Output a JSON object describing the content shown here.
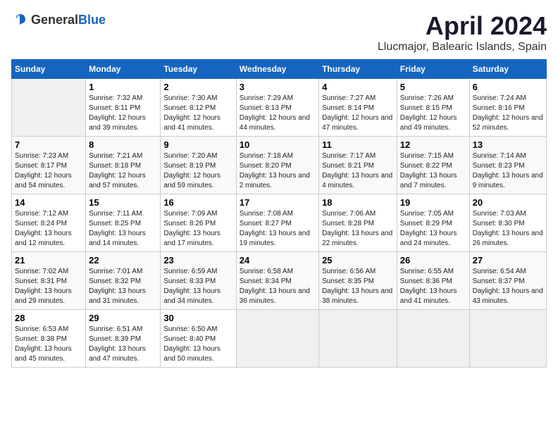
{
  "header": {
    "logo_general": "General",
    "logo_blue": "Blue",
    "title": "April 2024",
    "subtitle": "Llucmajor, Balearic Islands, Spain"
  },
  "columns": [
    "Sunday",
    "Monday",
    "Tuesday",
    "Wednesday",
    "Thursday",
    "Friday",
    "Saturday"
  ],
  "weeks": [
    [
      {
        "day": "",
        "sunrise": "",
        "sunset": "",
        "daylight": ""
      },
      {
        "day": "1",
        "sunrise": "Sunrise: 7:32 AM",
        "sunset": "Sunset: 8:11 PM",
        "daylight": "Daylight: 12 hours and 39 minutes."
      },
      {
        "day": "2",
        "sunrise": "Sunrise: 7:30 AM",
        "sunset": "Sunset: 8:12 PM",
        "daylight": "Daylight: 12 hours and 41 minutes."
      },
      {
        "day": "3",
        "sunrise": "Sunrise: 7:29 AM",
        "sunset": "Sunset: 8:13 PM",
        "daylight": "Daylight: 12 hours and 44 minutes."
      },
      {
        "day": "4",
        "sunrise": "Sunrise: 7:27 AM",
        "sunset": "Sunset: 8:14 PM",
        "daylight": "Daylight: 12 hours and 47 minutes."
      },
      {
        "day": "5",
        "sunrise": "Sunrise: 7:26 AM",
        "sunset": "Sunset: 8:15 PM",
        "daylight": "Daylight: 12 hours and 49 minutes."
      },
      {
        "day": "6",
        "sunrise": "Sunrise: 7:24 AM",
        "sunset": "Sunset: 8:16 PM",
        "daylight": "Daylight: 12 hours and 52 minutes."
      }
    ],
    [
      {
        "day": "7",
        "sunrise": "Sunrise: 7:23 AM",
        "sunset": "Sunset: 8:17 PM",
        "daylight": "Daylight: 12 hours and 54 minutes."
      },
      {
        "day": "8",
        "sunrise": "Sunrise: 7:21 AM",
        "sunset": "Sunset: 8:18 PM",
        "daylight": "Daylight: 12 hours and 57 minutes."
      },
      {
        "day": "9",
        "sunrise": "Sunrise: 7:20 AM",
        "sunset": "Sunset: 8:19 PM",
        "daylight": "Daylight: 12 hours and 59 minutes."
      },
      {
        "day": "10",
        "sunrise": "Sunrise: 7:18 AM",
        "sunset": "Sunset: 8:20 PM",
        "daylight": "Daylight: 13 hours and 2 minutes."
      },
      {
        "day": "11",
        "sunrise": "Sunrise: 7:17 AM",
        "sunset": "Sunset: 8:21 PM",
        "daylight": "Daylight: 13 hours and 4 minutes."
      },
      {
        "day": "12",
        "sunrise": "Sunrise: 7:15 AM",
        "sunset": "Sunset: 8:22 PM",
        "daylight": "Daylight: 13 hours and 7 minutes."
      },
      {
        "day": "13",
        "sunrise": "Sunrise: 7:14 AM",
        "sunset": "Sunset: 8:23 PM",
        "daylight": "Daylight: 13 hours and 9 minutes."
      }
    ],
    [
      {
        "day": "14",
        "sunrise": "Sunrise: 7:12 AM",
        "sunset": "Sunset: 8:24 PM",
        "daylight": "Daylight: 13 hours and 12 minutes."
      },
      {
        "day": "15",
        "sunrise": "Sunrise: 7:11 AM",
        "sunset": "Sunset: 8:25 PM",
        "daylight": "Daylight: 13 hours and 14 minutes."
      },
      {
        "day": "16",
        "sunrise": "Sunrise: 7:09 AM",
        "sunset": "Sunset: 8:26 PM",
        "daylight": "Daylight: 13 hours and 17 minutes."
      },
      {
        "day": "17",
        "sunrise": "Sunrise: 7:08 AM",
        "sunset": "Sunset: 8:27 PM",
        "daylight": "Daylight: 13 hours and 19 minutes."
      },
      {
        "day": "18",
        "sunrise": "Sunrise: 7:06 AM",
        "sunset": "Sunset: 8:28 PM",
        "daylight": "Daylight: 13 hours and 22 minutes."
      },
      {
        "day": "19",
        "sunrise": "Sunrise: 7:05 AM",
        "sunset": "Sunset: 8:29 PM",
        "daylight": "Daylight: 13 hours and 24 minutes."
      },
      {
        "day": "20",
        "sunrise": "Sunrise: 7:03 AM",
        "sunset": "Sunset: 8:30 PM",
        "daylight": "Daylight: 13 hours and 26 minutes."
      }
    ],
    [
      {
        "day": "21",
        "sunrise": "Sunrise: 7:02 AM",
        "sunset": "Sunset: 8:31 PM",
        "daylight": "Daylight: 13 hours and 29 minutes."
      },
      {
        "day": "22",
        "sunrise": "Sunrise: 7:01 AM",
        "sunset": "Sunset: 8:32 PM",
        "daylight": "Daylight: 13 hours and 31 minutes."
      },
      {
        "day": "23",
        "sunrise": "Sunrise: 6:59 AM",
        "sunset": "Sunset: 8:33 PM",
        "daylight": "Daylight: 13 hours and 34 minutes."
      },
      {
        "day": "24",
        "sunrise": "Sunrise: 6:58 AM",
        "sunset": "Sunset: 8:34 PM",
        "daylight": "Daylight: 13 hours and 36 minutes."
      },
      {
        "day": "25",
        "sunrise": "Sunrise: 6:56 AM",
        "sunset": "Sunset: 8:35 PM",
        "daylight": "Daylight: 13 hours and 38 minutes."
      },
      {
        "day": "26",
        "sunrise": "Sunrise: 6:55 AM",
        "sunset": "Sunset: 8:36 PM",
        "daylight": "Daylight: 13 hours and 41 minutes."
      },
      {
        "day": "27",
        "sunrise": "Sunrise: 6:54 AM",
        "sunset": "Sunset: 8:37 PM",
        "daylight": "Daylight: 13 hours and 43 minutes."
      }
    ],
    [
      {
        "day": "28",
        "sunrise": "Sunrise: 6:53 AM",
        "sunset": "Sunset: 8:38 PM",
        "daylight": "Daylight: 13 hours and 45 minutes."
      },
      {
        "day": "29",
        "sunrise": "Sunrise: 6:51 AM",
        "sunset": "Sunset: 8:39 PM",
        "daylight": "Daylight: 13 hours and 47 minutes."
      },
      {
        "day": "30",
        "sunrise": "Sunrise: 6:50 AM",
        "sunset": "Sunset: 8:40 PM",
        "daylight": "Daylight: 13 hours and 50 minutes."
      },
      {
        "day": "",
        "sunrise": "",
        "sunset": "",
        "daylight": ""
      },
      {
        "day": "",
        "sunrise": "",
        "sunset": "",
        "daylight": ""
      },
      {
        "day": "",
        "sunrise": "",
        "sunset": "",
        "daylight": ""
      },
      {
        "day": "",
        "sunrise": "",
        "sunset": "",
        "daylight": ""
      }
    ]
  ]
}
